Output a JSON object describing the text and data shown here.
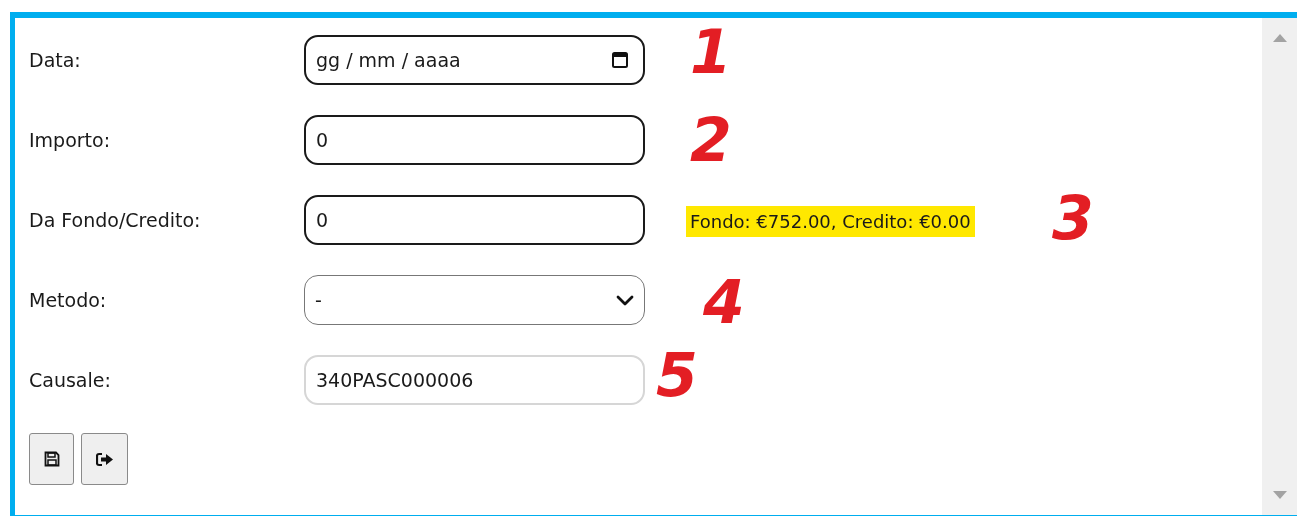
{
  "fields": [
    {
      "label": "Data:",
      "kind": "date",
      "placeholder": "gg / mm / aaaa",
      "emphasized": true
    },
    {
      "label": "Importo:",
      "kind": "input",
      "value": "0",
      "emphasized": true
    },
    {
      "label": "Da Fondo/Credito:",
      "kind": "input",
      "value": "0",
      "emphasized": true,
      "note": "Fondo: €752.00, Credito: €0.00"
    },
    {
      "label": "Metodo:",
      "kind": "select",
      "value": "-",
      "emphasized": false
    },
    {
      "label": "Causale:",
      "kind": "input",
      "value": "340PASC000006",
      "emphasized": false
    }
  ],
  "buttons": [
    {
      "kind": "save"
    },
    {
      "kind": "exit"
    }
  ],
  "annotations": [
    "1",
    "2",
    "3",
    "4",
    "5"
  ]
}
